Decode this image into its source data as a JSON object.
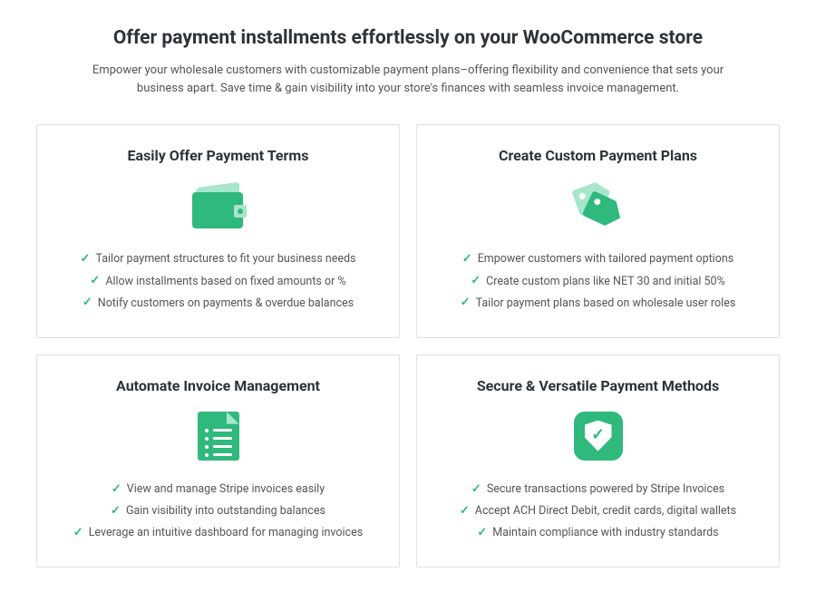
{
  "header": {
    "title": "Offer payment installments effortlessly on your WooCommerce store",
    "subtitle": "Empower your wholesale customers with customizable payment plans–offering flexibility and convenience that sets your business apart. Save time & gain visibility into your store's finances with seamless invoice management."
  },
  "cards": [
    {
      "title": "Easily Offer Payment Terms",
      "icon": "wallet-icon",
      "bullets": [
        "Tailor payment structures to fit your business needs",
        "Allow installments based on fixed amounts or %",
        "Notify customers on payments & overdue balances"
      ]
    },
    {
      "title": "Create Custom Payment Plans",
      "icon": "tags-icon",
      "bullets": [
        "Empower customers with tailored payment options",
        "Create custom plans like NET 30 and initial 50%",
        "Tailor payment plans based on wholesale user roles"
      ]
    },
    {
      "title": "Automate Invoice Management",
      "icon": "document-list-icon",
      "bullets": [
        "View and manage Stripe invoices easily",
        "Gain visibility into outstanding balances",
        "Leverage an intuitive dashboard for managing invoices"
      ]
    },
    {
      "title": "Secure & Versatile Payment Methods",
      "icon": "shield-check-icon",
      "bullets": [
        "Secure transactions powered by Stripe Invoices",
        "Accept ACH Direct Debit, credit cards, digital wallets",
        "Maintain compliance with industry standards"
      ]
    }
  ]
}
